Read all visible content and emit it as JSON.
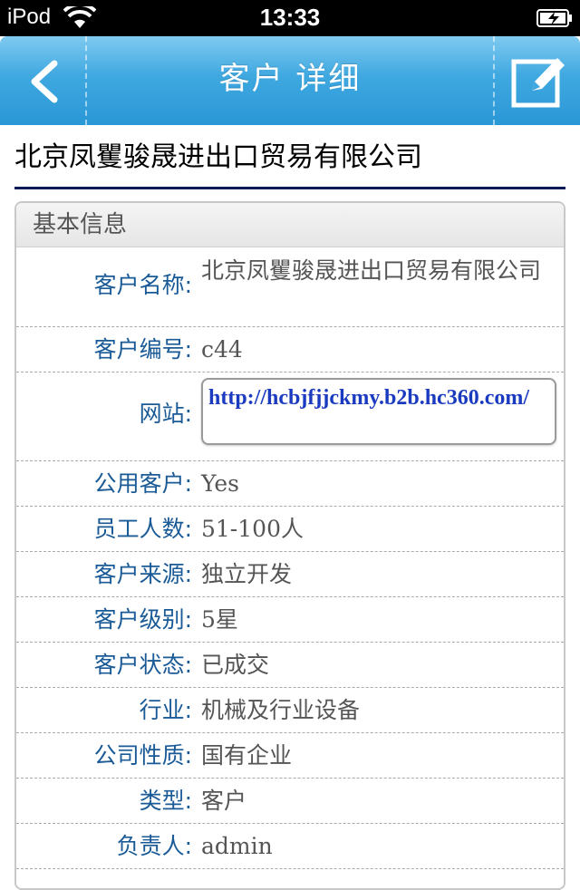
{
  "status_bar": {
    "carrier": "iPod",
    "time": "13:33"
  },
  "nav": {
    "title": "客户 详细",
    "back_icon": "chevron-left-icon",
    "edit_icon": "edit-icon"
  },
  "company": {
    "name": "北京凤矍骏晟进出口贸易有限公司"
  },
  "section": {
    "header": "基本信息"
  },
  "fields": [
    {
      "label": "客户名称:",
      "value": "北京凤矍骏晟进出口贸易有限公司"
    },
    {
      "label": "客户编号:",
      "value": "c44"
    },
    {
      "label": "网站:",
      "value": "http://hcbjfjjckmy.b2b.hc360.com/"
    },
    {
      "label": "公用客户:",
      "value": "Yes"
    },
    {
      "label": "员工人数:",
      "value": "51-100人"
    },
    {
      "label": "客户来源:",
      "value": "独立开发"
    },
    {
      "label": "客户级别:",
      "value": "5星"
    },
    {
      "label": "客户状态:",
      "value": "已成交"
    },
    {
      "label": "行业:",
      "value": "机械及行业设备"
    },
    {
      "label": "公司性质:",
      "value": "国有企业"
    },
    {
      "label": "类型:",
      "value": "客户"
    },
    {
      "label": "负责人:",
      "value": "admin"
    }
  ],
  "colors": {
    "nav_gradient_top": "#7fcaf0",
    "nav_gradient_bottom": "#2a97d6",
    "label_color": "#1a5a96",
    "link_color": "#1a3bbf",
    "title_rule": "#0b1a55"
  }
}
